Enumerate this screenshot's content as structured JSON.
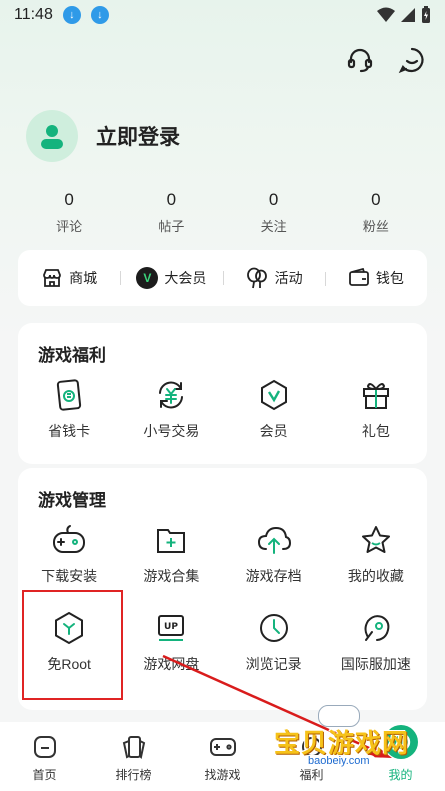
{
  "status": {
    "time": "11:48"
  },
  "profile": {
    "login_label": "立即登录"
  },
  "stats": [
    {
      "value": "0",
      "label": "评论"
    },
    {
      "value": "0",
      "label": "帖子"
    },
    {
      "value": "0",
      "label": "关注"
    },
    {
      "value": "0",
      "label": "粉丝"
    }
  ],
  "quickbar": {
    "shop": "商城",
    "vip_badge": "V",
    "vip": "大会员",
    "activity": "活动",
    "wallet": "钱包"
  },
  "welfare": {
    "title": "游戏福利",
    "items": [
      "省钱卡",
      "小号交易",
      "会员",
      "礼包"
    ]
  },
  "manage": {
    "title": "游戏管理",
    "row1": [
      "下载安装",
      "游戏合集",
      "游戏存档",
      "我的收藏"
    ],
    "row2": [
      "免Root",
      "游戏网盘",
      "浏览记录",
      "国际服加速"
    ],
    "cloud_badge": "UP"
  },
  "tabs": [
    "首页",
    "排行榜",
    "找游戏",
    "福利",
    "我的"
  ],
  "watermark": {
    "title": "宝贝游戏网",
    "domain": "baobeiy.com"
  },
  "colors": {
    "accent": "#14b37d",
    "highlight": "#e02424"
  }
}
